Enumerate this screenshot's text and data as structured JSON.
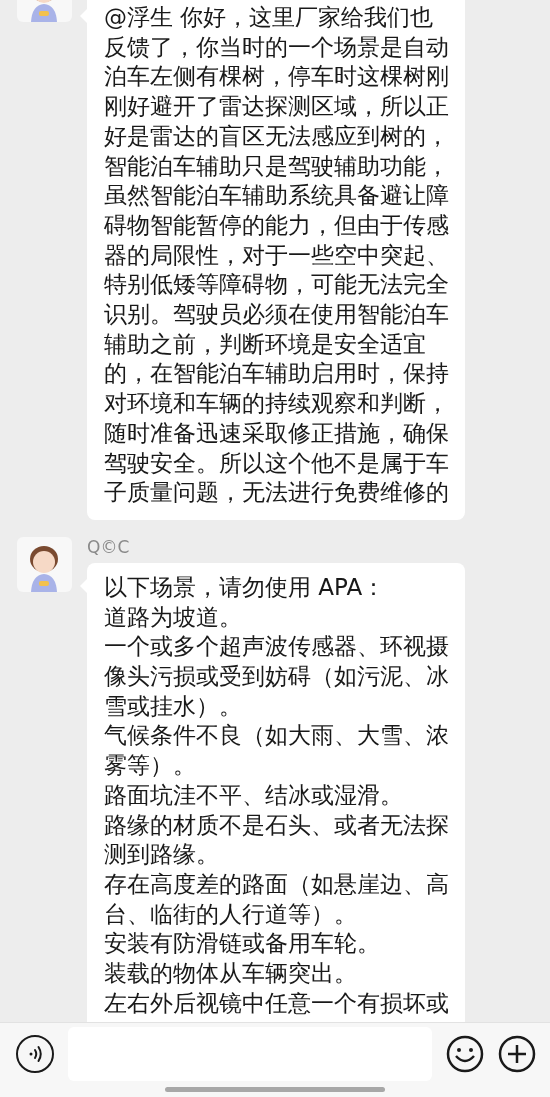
{
  "messages": [
    {
      "lines": [
        "@浮生  你好，这里厂家给我们也反馈了，你当时的一个场景是自动泊车左侧有棵树，停车时这棵树刚刚好避开了雷达探测区域，所以正好是雷达的盲区无法感应到树的，智能泊车辅助只是驾驶辅助功能，虽然智能泊车辅助系统具备避让障碍物智能暂停的能力，但由于传感器的局限性，对于一些空中突起、特别低矮等障碍物，可能无法完全识别。驾驶员必须在使用智能泊车辅助之前，判断环境是安全适宜的，在智能泊车辅助启用时，保持对环境和车辆的持续观察和判断，随时准备迅速采取修正措施，确保驾驶安全。所以这个他不是属于车子质量问题，无法进行免费维修的"
      ]
    },
    {
      "sender": "Q©C",
      "lines": [
        "以下场景，请勿使用 APA：",
        "道路为坡道。",
        "一个或多个超声波传感器、环视摄像头污损或受到妨碍（如污泥、冰雪或挂水）。",
        "气候条件不良（如大雨、大雪、浓雾等）。",
        "路面坑洼不平、结冰或湿滑。",
        "路缘的材质不是石头、或者无法探测到路缘。",
        "存在高度差的路面（如悬崖边、高台、临街的人行道等）。",
        "安装有防滑链或备用车轮。",
        "装载的物体从车辆突出。",
        "左右外后视镜中任意一个有损坏或"
      ]
    }
  ]
}
